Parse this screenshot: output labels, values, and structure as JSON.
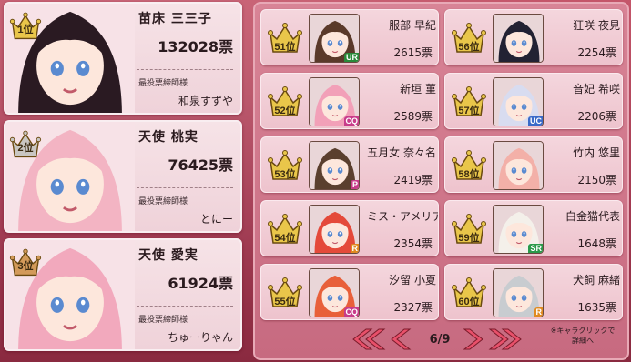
{
  "top_ranks": [
    {
      "rank": "1位",
      "name": "苗床 三三子",
      "votes": "132028票",
      "voter_label": "最投票締師様",
      "voter": "和泉すずや",
      "hair": "#2a1a22",
      "rank_color": "#e9c64a"
    },
    {
      "rank": "2位",
      "name": "天使 桃実",
      "votes": "76425票",
      "voter_label": "最投票締師様",
      "voter": "とにー",
      "hair": "#f3b4c3",
      "rank_color": "#c9c6c2"
    },
    {
      "rank": "3位",
      "name": "天使 愛実",
      "votes": "61924票",
      "voter_label": "最投票締師様",
      "voter": "ちゅーりゃん",
      "hair": "#f2a9bd",
      "rank_color": "#d39a5a"
    }
  ],
  "ranking_left": [
    {
      "rank": "51位",
      "name": "服部 早紀",
      "votes": "2615票",
      "badge": "UR",
      "badge_color": "#2a8a3a",
      "hair": "#5a3a2a"
    },
    {
      "rank": "52位",
      "name": "新垣 菫",
      "votes": "2589票",
      "badge": "CQ",
      "badge_color": "#c83c8a",
      "hair": "#f2a0b8"
    },
    {
      "rank": "53位",
      "name": "五月女 奈々名",
      "votes": "2419票",
      "badge": "P",
      "badge_color": "#c83c8a",
      "hair": "#5a3f2e"
    },
    {
      "rank": "54位",
      "name": "ミス・アメリア",
      "votes": "2354票",
      "badge": "R",
      "badge_color": "#e08a20",
      "hair": "#e44a3a"
    },
    {
      "rank": "55位",
      "name": "汐留 小夏",
      "votes": "2327票",
      "badge": "CQ",
      "badge_color": "#c83c8a",
      "hair": "#e8603a"
    }
  ],
  "ranking_right": [
    {
      "rank": "56位",
      "name": "狂咲 夜見",
      "votes": "2254票",
      "badge": "",
      "badge_color": "#c83c8a",
      "hair": "#222233"
    },
    {
      "rank": "57位",
      "name": "音妃 希咲",
      "votes": "2206票",
      "badge": "UC",
      "badge_color": "#3a6ac8",
      "hair": "#d8dcf0"
    },
    {
      "rank": "58位",
      "name": "竹内 悠里",
      "votes": "2150票",
      "badge": "",
      "badge_color": "#c83c8a",
      "hair": "#f3b0a8"
    },
    {
      "rank": "59位",
      "name": "白金猫代表",
      "votes": "1648票",
      "badge": "SR",
      "badge_color": "#2a9a4a",
      "hair": "#f4f0ea"
    },
    {
      "rank": "60位",
      "name": "犬飼 麻緒",
      "votes": "1635票",
      "badge": "R",
      "badge_color": "#e08a20",
      "hair": "#c8ccd0"
    }
  ],
  "pager": {
    "page": "6/9",
    "first_icon": "double-chevron-left-icon",
    "prev_icon": "chevron-left-icon",
    "next_icon": "chevron-right-icon",
    "last_icon": "double-chevron-right-icon"
  },
  "note": {
    "line1": "※キャラクリックで",
    "line2": "詳細へ"
  },
  "colors": {
    "accent": "#e8506a",
    "panel": "#d88496",
    "card": "#f4d6dd"
  }
}
